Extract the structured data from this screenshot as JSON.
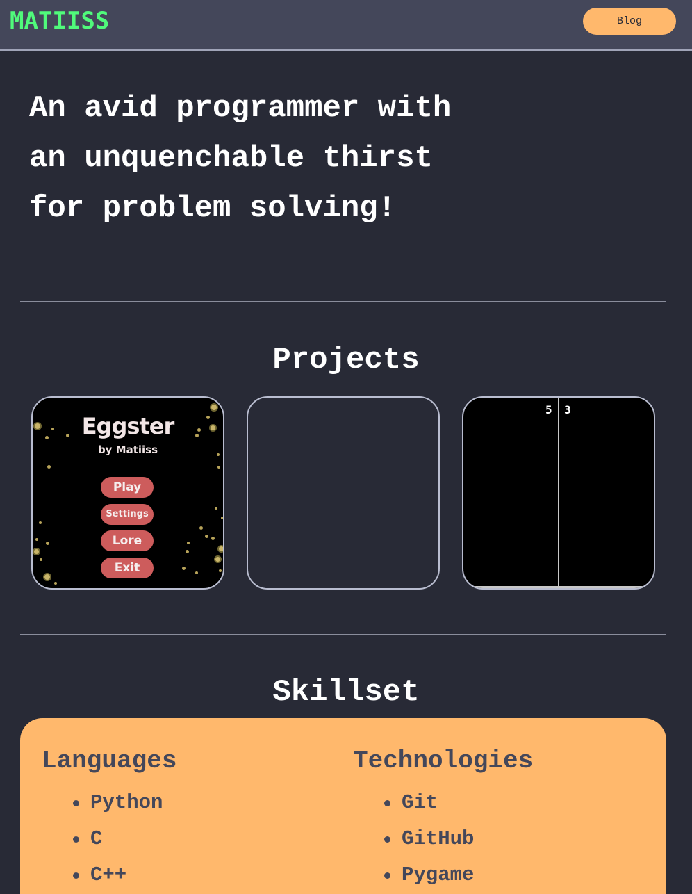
{
  "header": {
    "logo": "MATIISS",
    "blog_label": "Blog"
  },
  "hero": {
    "lines": [
      "An avid programmer with",
      "an unquenchable thirst",
      "for problem solving!"
    ]
  },
  "projects": {
    "title": "Projects",
    "eggster": {
      "title": "Eggster",
      "subtitle": "by Matiiss",
      "buttons": [
        "Play",
        "Settings",
        "Lore",
        "Exit"
      ]
    },
    "pong": {
      "score_left": "5",
      "score_right": "3"
    }
  },
  "skillset": {
    "title": "Skillset",
    "languages": {
      "heading": "Languages",
      "items": [
        "Python",
        "C",
        "C++"
      ]
    },
    "technologies": {
      "heading": "Technologies",
      "items": [
        "Git",
        "GitHub",
        "Pygame"
      ]
    }
  },
  "colors": {
    "background": "#282a36",
    "topbar": "#44475a",
    "logo": "#50fa7b",
    "accent": "#ffb86c",
    "egg_button": "#cd5c5c"
  }
}
